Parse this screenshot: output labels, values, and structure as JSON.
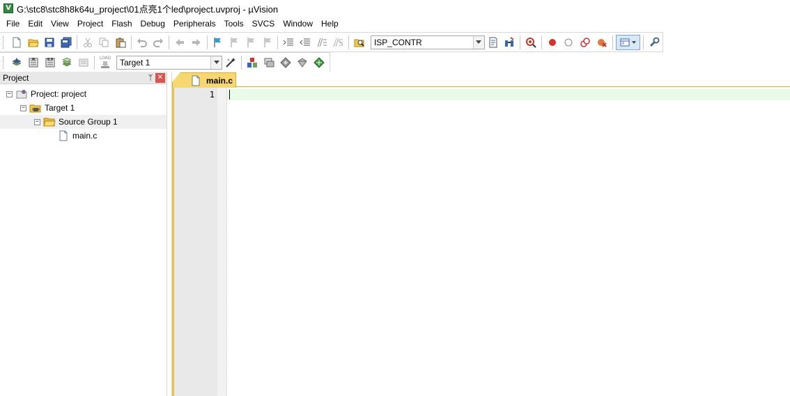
{
  "window": {
    "title": "G:\\stc8\\stc8h8k64u_project\\01点亮1个led\\project.uvproj - µVision",
    "app_icon_letter": "V"
  },
  "menu": [
    "File",
    "Edit",
    "View",
    "Project",
    "Flash",
    "Debug",
    "Peripherals",
    "Tools",
    "SVCS",
    "Window",
    "Help"
  ],
  "toolbar1": {
    "find_combo_value": "ISP_CONTR"
  },
  "toolbar2": {
    "target_value": "Target 1",
    "load_label": "LOAD"
  },
  "project_panel": {
    "title": "Project",
    "pin_glyph": "ᛘ",
    "close_glyph": "✕",
    "tree": {
      "root": {
        "label": "Project: project",
        "expander": "−"
      },
      "target": {
        "label": "Target 1",
        "expander": "−"
      },
      "group": {
        "label": "Source Group 1",
        "expander": "−"
      },
      "file": {
        "label": "main.c"
      }
    }
  },
  "editor": {
    "tab_label": "main.c",
    "line_numbers": [
      "1"
    ]
  }
}
